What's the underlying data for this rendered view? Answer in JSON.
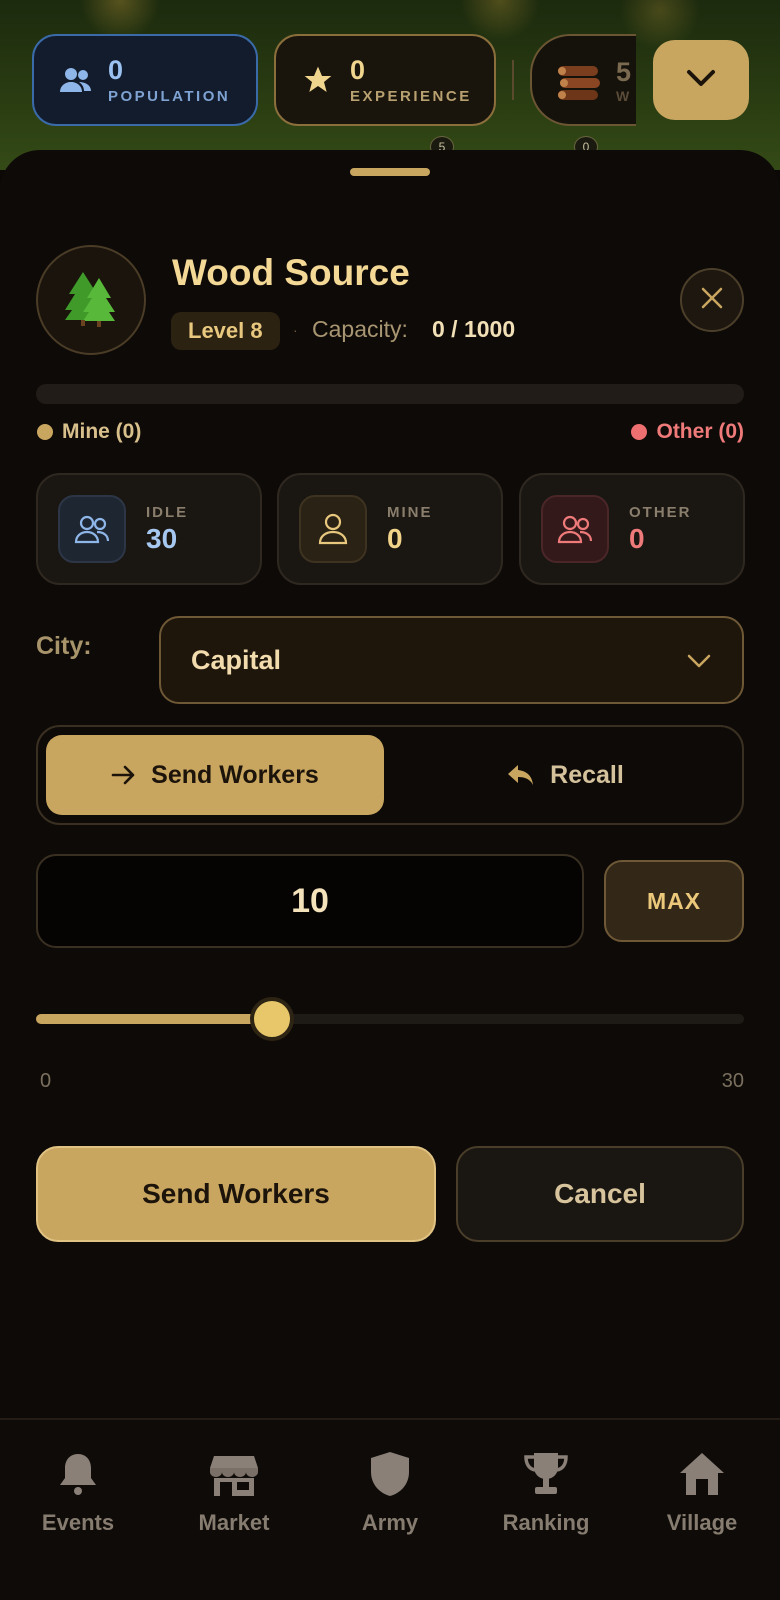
{
  "topbar": {
    "population": {
      "value": "0",
      "label": "POPULATION",
      "icon": "users-icon"
    },
    "experience": {
      "value": "0",
      "label": "EXPERIENCE",
      "icon": "star-icon"
    },
    "wood": {
      "value": "5",
      "label": "W",
      "icon": "wood-logs-icon"
    },
    "collapse_icon": "chevron-down-icon"
  },
  "map_markers": [
    "5",
    "0"
  ],
  "resource": {
    "title": "Wood Source",
    "level": "Level 8",
    "separator": "·",
    "capacity_label": "Capacity:",
    "capacity_value": "0 / 1000",
    "capacity_fill": 0,
    "icon": "pine-trees-icon"
  },
  "legend": {
    "mine": "Mine (0)",
    "other": "Other (0)",
    "mine_color": "#c9a660",
    "other_color": "#ee6f6f"
  },
  "stats": [
    {
      "label": "IDLE",
      "value": "30",
      "icon": "users-icon"
    },
    {
      "label": "MINE",
      "value": "0",
      "icon": "user-icon"
    },
    {
      "label": "OTHER",
      "value": "0",
      "icon": "users-icon"
    }
  ],
  "city": {
    "label": "City:",
    "selected": "Capital"
  },
  "mode_toggle": {
    "send_label": "Send Workers",
    "recall_label": "Recall",
    "active": "send"
  },
  "quantity": {
    "value": "10",
    "max_label": "MAX"
  },
  "slider": {
    "min": "0",
    "max": "30",
    "value": 10
  },
  "actions": {
    "primary": "Send Workers",
    "secondary": "Cancel"
  },
  "nav": [
    {
      "label": "Events",
      "icon": "bell-icon"
    },
    {
      "label": "Market",
      "icon": "shop-icon"
    },
    {
      "label": "Army",
      "icon": "shield-icon"
    },
    {
      "label": "Ranking",
      "icon": "trophy-icon"
    },
    {
      "label": "Village",
      "icon": "house-icon"
    }
  ],
  "colors": {
    "accent": "#c9a660",
    "background": "#0e0a07",
    "idle_blue": "#a6c8f0",
    "other_red": "#ee7a7a"
  }
}
